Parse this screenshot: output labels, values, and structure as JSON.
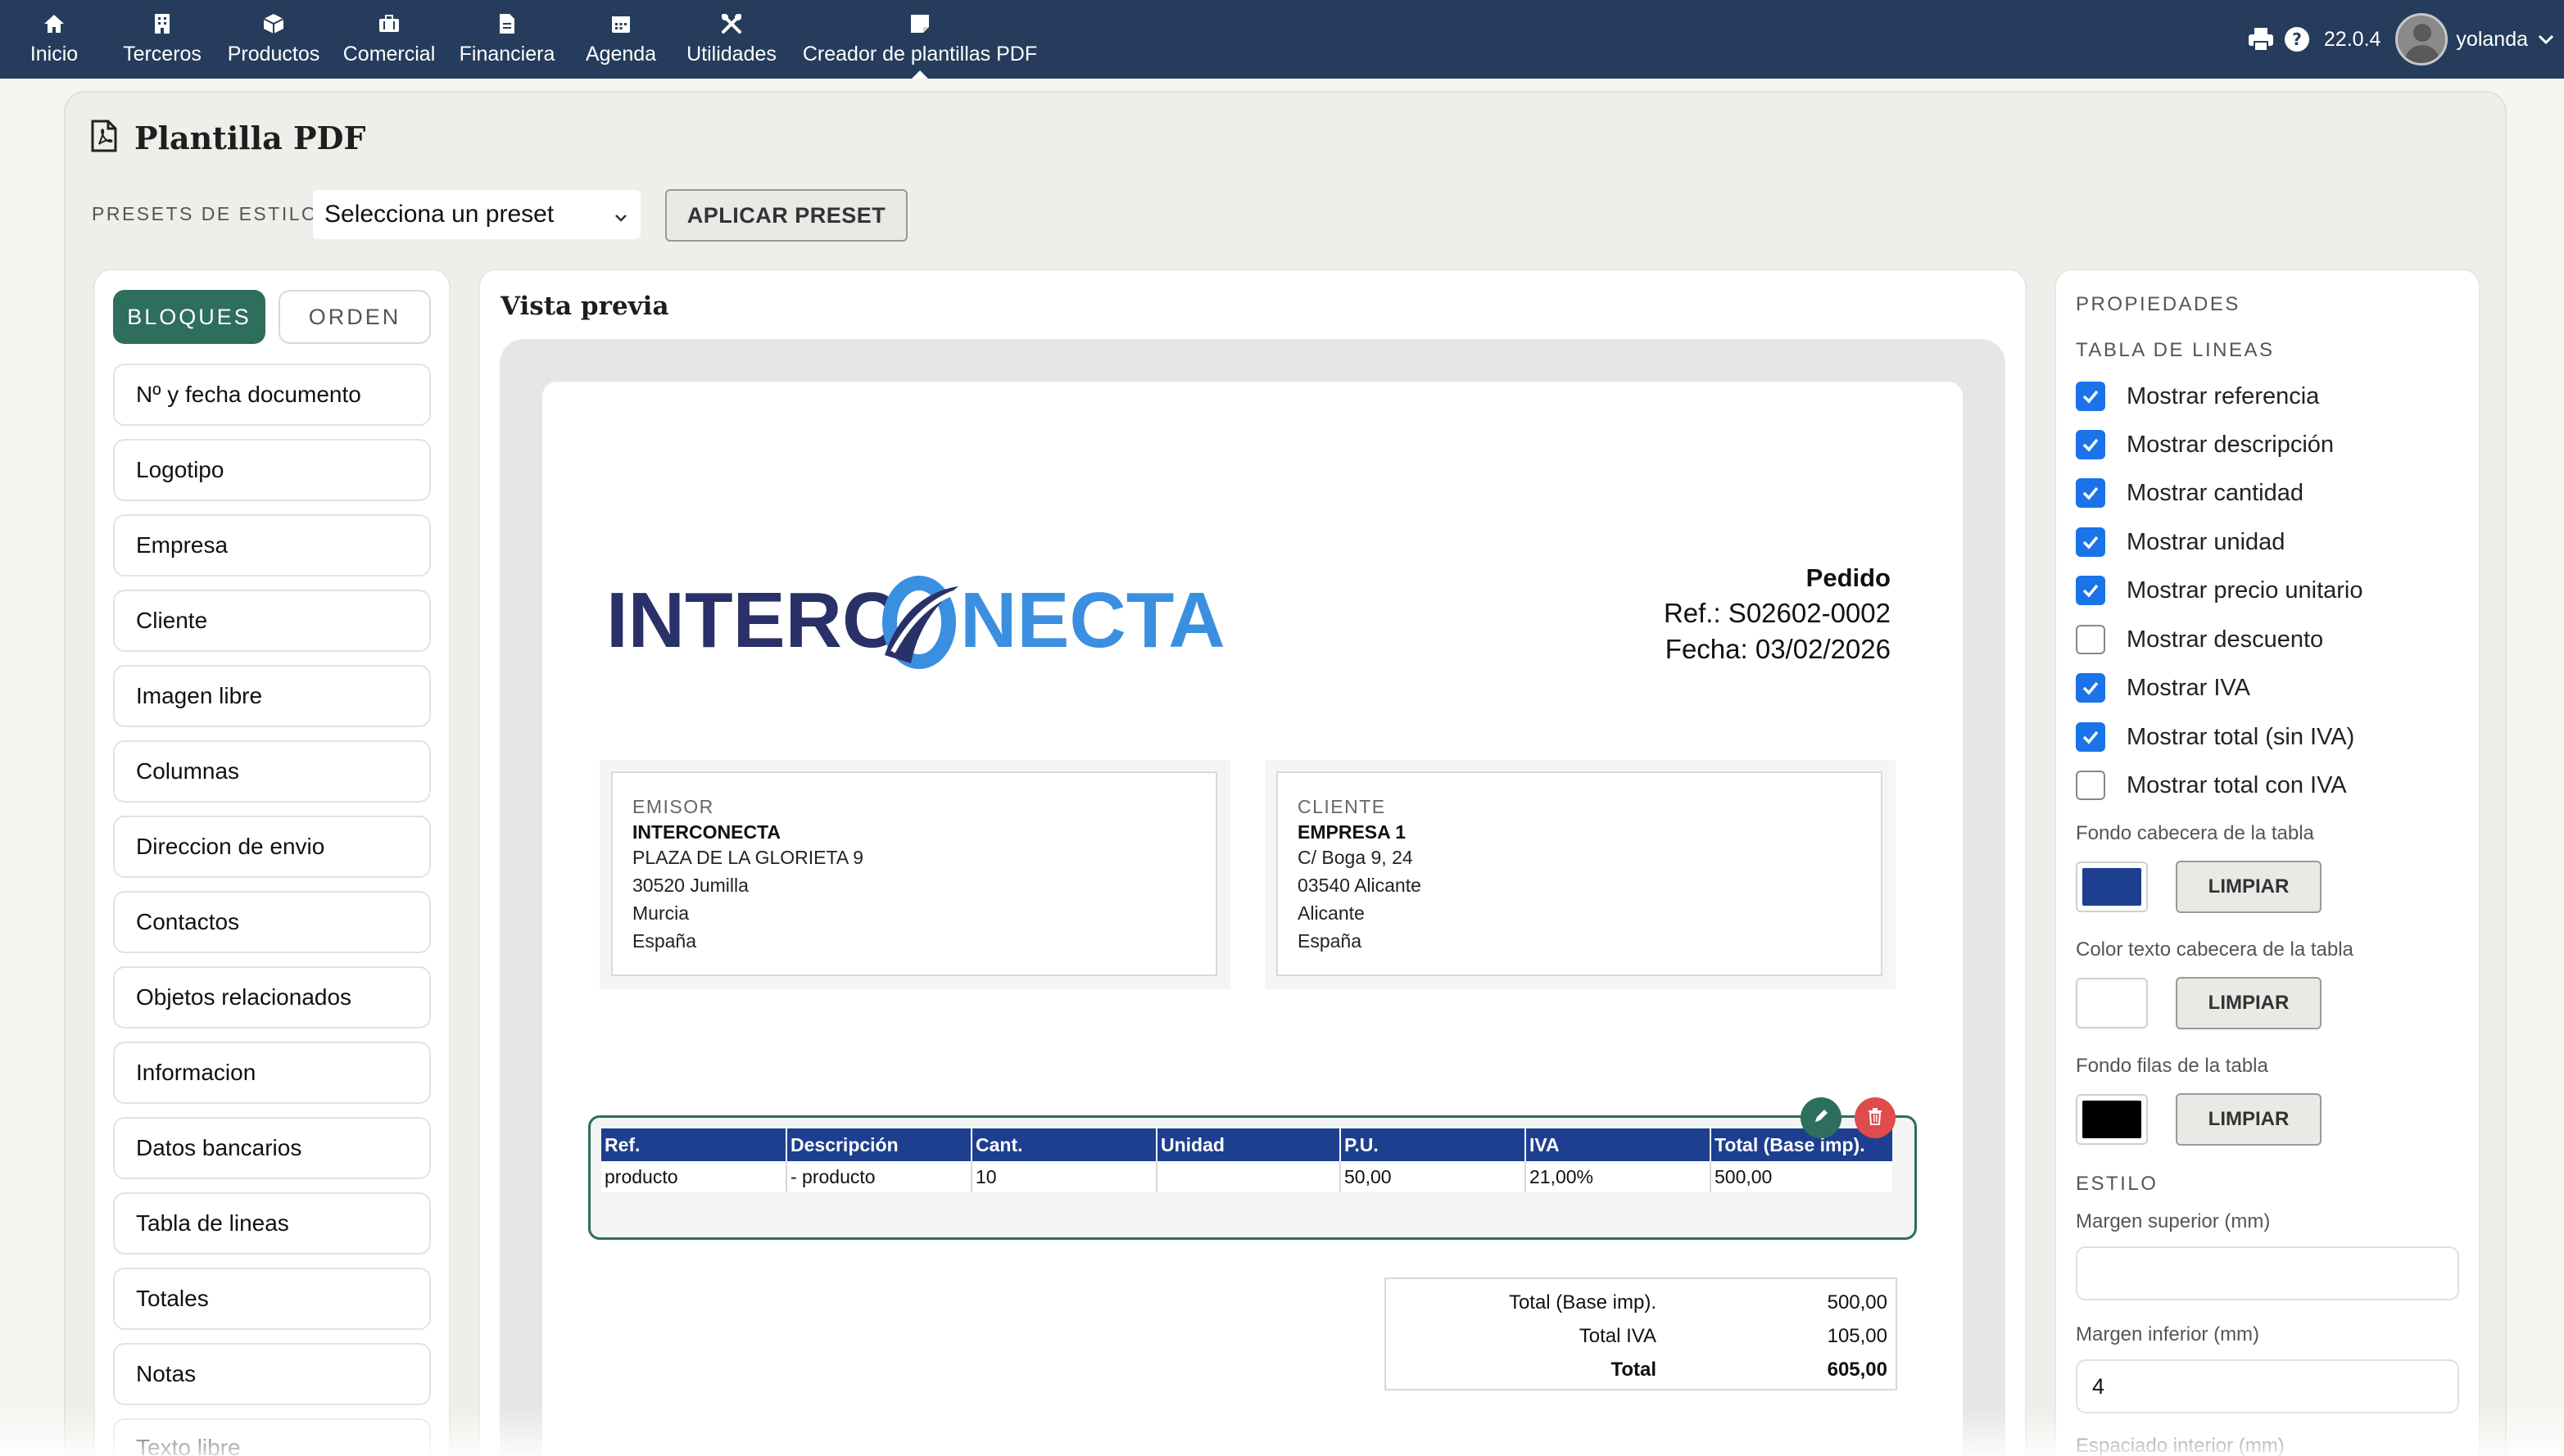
{
  "nav": {
    "items": [
      {
        "label": "Inicio",
        "icon": "home-icon"
      },
      {
        "label": "Terceros",
        "icon": "building-icon"
      },
      {
        "label": "Productos",
        "icon": "cube-icon"
      },
      {
        "label": "Comercial",
        "icon": "briefcase-icon"
      },
      {
        "label": "Financiera",
        "icon": "invoice-icon"
      },
      {
        "label": "Agenda",
        "icon": "calendar-icon"
      },
      {
        "label": "Utilidades",
        "icon": "tools-icon"
      },
      {
        "label": "Creador de plantillas PDF",
        "icon": "note-icon"
      }
    ],
    "active": "Creador de plantillas PDF",
    "version": "22.0.4",
    "user": "yolanda"
  },
  "page": {
    "title": "Plantilla PDF",
    "presets_label": "PRESETS DE ESTILO",
    "preset_select": "Selecciona un preset",
    "apply_button": "APLICAR PRESET"
  },
  "blocks": {
    "tab_blocks": "BLOQUES",
    "tab_order": "ORDEN",
    "items": [
      "Nº y fecha documento",
      "Logotipo",
      "Empresa",
      "Cliente",
      "Imagen libre",
      "Columnas",
      "Direccion de envio",
      "Contactos",
      "Objetos relacionados",
      "Informacion",
      "Datos bancarios",
      "Tabla de lineas",
      "Totales",
      "Notas",
      "Texto libre"
    ]
  },
  "preview": {
    "title": "Vista previa",
    "logo": {
      "text_dark": "INTERC",
      "text_light": "NECTA",
      "color_dark": "#2a3168",
      "color_light": "#3b8fe0"
    },
    "doc_type": "Pedido",
    "ref": "Ref.: S02602-0002",
    "date": "Fecha: 03/02/2026",
    "emisor": {
      "header": "EMISOR",
      "name": "INTERCONECTA",
      "lines": [
        "PLAZA DE LA GLORIETA 9",
        "30520 Jumilla",
        "Murcia",
        "España"
      ]
    },
    "cliente": {
      "header": "CLIENTE",
      "name": "EMPRESA 1",
      "lines": [
        "C/ Boga 9, 24",
        "03540 Alicante",
        "Alicante",
        "España"
      ]
    },
    "table": {
      "headers": [
        "Ref.",
        "Descripción",
        "Cant.",
        "Unidad",
        "P.U.",
        "IVA",
        "Total (Base imp)."
      ],
      "rows": [
        [
          "producto",
          "- producto",
          "10",
          "",
          "50,00",
          "21,00%",
          "500,00"
        ]
      ],
      "header_bg": "#1e3f8f"
    },
    "totals": [
      {
        "label": "Total (Base imp).",
        "value": "500,00",
        "bold": false
      },
      {
        "label": "Total IVA",
        "value": "105,00",
        "bold": false
      },
      {
        "label": "Total",
        "value": "605,00",
        "bold": true
      }
    ]
  },
  "props": {
    "title": "PROPIEDADES",
    "section": "TABLA DE LINEAS",
    "checks": [
      {
        "label": "Mostrar referencia",
        "checked": true
      },
      {
        "label": "Mostrar descripción",
        "checked": true
      },
      {
        "label": "Mostrar cantidad",
        "checked": true
      },
      {
        "label": "Mostrar unidad",
        "checked": true
      },
      {
        "label": "Mostrar precio unitario",
        "checked": true
      },
      {
        "label": "Mostrar descuento",
        "checked": false
      },
      {
        "label": "Mostrar IVA",
        "checked": true
      },
      {
        "label": "Mostrar total (sin IVA)",
        "checked": true
      },
      {
        "label": "Mostrar total con IVA",
        "checked": false
      }
    ],
    "colors": [
      {
        "label": "Fondo cabecera de la tabla",
        "value": "#1e3f8f"
      },
      {
        "label": "Color texto cabecera de la tabla",
        "value": "#ffffff"
      },
      {
        "label": "Fondo filas de la tabla",
        "value": "#000000"
      }
    ],
    "clear_button": "LIMPIAR",
    "style_section": "ESTILO",
    "margin_top_label": "Margen superior (mm)",
    "margin_top_value": "",
    "margin_bottom_label": "Margen inferior (mm)",
    "margin_bottom_value": "4",
    "padding_label": "Espaciado interior (mm)"
  }
}
